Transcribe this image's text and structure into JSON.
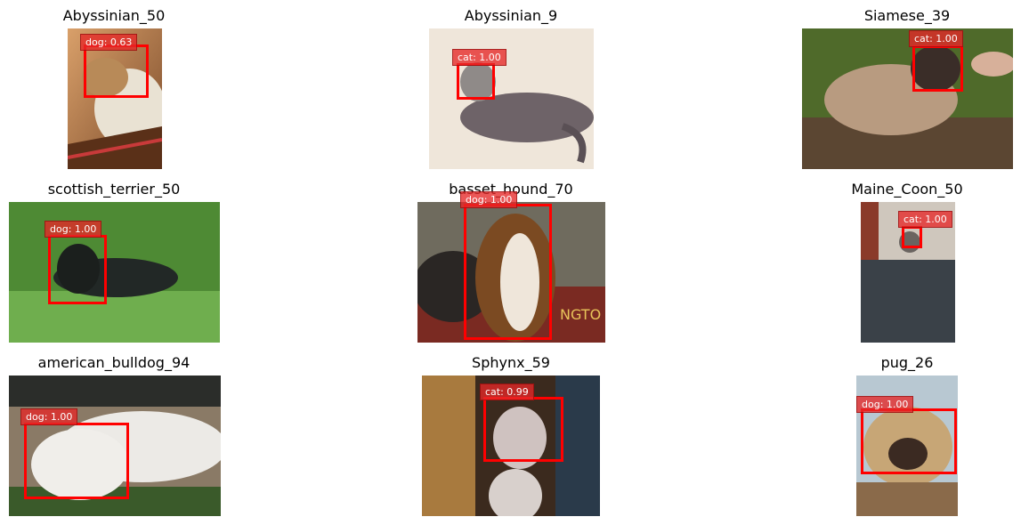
{
  "panels": [
    {
      "title": "Abyssinian_50",
      "label": "dog: 0.63",
      "colors": {
        "box": "#ff0000"
      }
    },
    {
      "title": "Abyssinian_9",
      "label": "cat: 1.00"
    },
    {
      "title": "Siamese_39",
      "label": "cat: 1.00"
    },
    {
      "title": "scottish_terrier_50",
      "label": "dog: 1.00"
    },
    {
      "title": "basset_hound_70",
      "label": "dog: 1.00"
    },
    {
      "title": "Maine_Coon_50",
      "label": "cat: 1.00"
    },
    {
      "title": "american_bulldog_94",
      "label": "dog: 1.00"
    },
    {
      "title": "Sphynx_59",
      "label": "cat: 0.99"
    },
    {
      "title": "pug_26",
      "label": "dog: 1.00"
    }
  ]
}
